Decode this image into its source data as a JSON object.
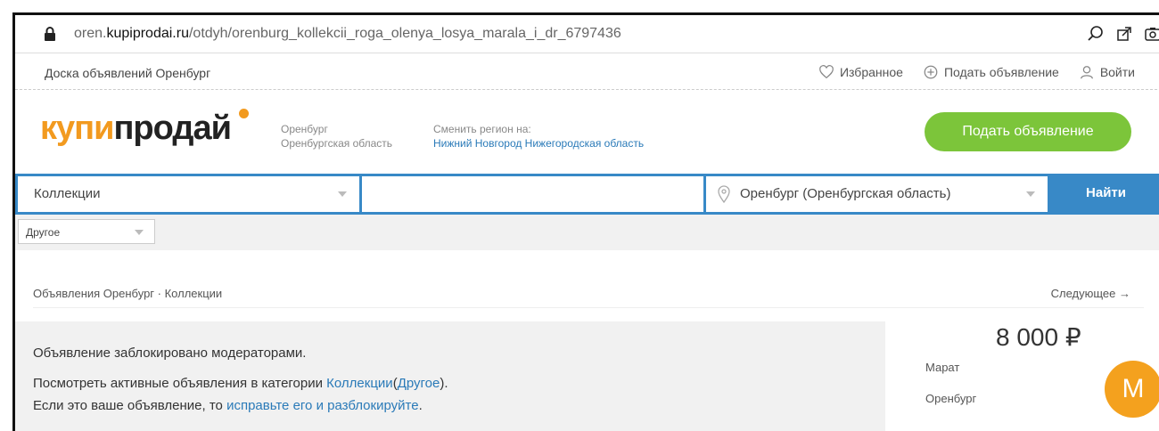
{
  "browser": {
    "url_prefix": "oren.",
    "url_domain": "kupiprodai.ru",
    "url_path": "/otdyh/orenburg_kollekcii_roga_olenya_losya_marala_i_dr_6797436"
  },
  "topbar": {
    "site_title": "Доска объявлений Оренбург",
    "favorites": "Избранное",
    "post_ad": "Подать объявление",
    "login": "Войти"
  },
  "header": {
    "logo_part1": "купи",
    "logo_part2": "продай",
    "city": "Оренбург",
    "region": "Оренбургская область",
    "change_label": "Сменить регион на:",
    "change_link": "Нижний Новгород Нижегородская область",
    "post_button": "Подать объявление"
  },
  "search": {
    "category": "Коллекции",
    "query": "",
    "location": "Оренбург (Оренбургская область)",
    "find_button": "Найти"
  },
  "filters": {
    "subcategory": "Другое"
  },
  "breadcrumb": {
    "text": "Объявления Оренбург · Коллекции",
    "next": "Следующее →"
  },
  "notice": {
    "line1": "Объявление заблокировано модераторами.",
    "line2_prefix": "Посмотреть активные объявления в категории ",
    "line2_link1": "Коллекции",
    "line2_mid": "(",
    "line2_link2": "Другое",
    "line2_suffix": ").",
    "line3_prefix": "Если это ваше объявление, то ",
    "line3_link": "исправьте его и разблокируйте",
    "line3_suffix": "."
  },
  "listing": {
    "price": "8 000 ₽",
    "seller_name": "Марат",
    "seller_city": "Оренбург",
    "avatar_letter": "М"
  },
  "colors": {
    "brand_orange": "#f29a1f",
    "post_green": "#7cc53a",
    "search_blue": "#3889c7",
    "link_blue": "#2a7ab8"
  }
}
